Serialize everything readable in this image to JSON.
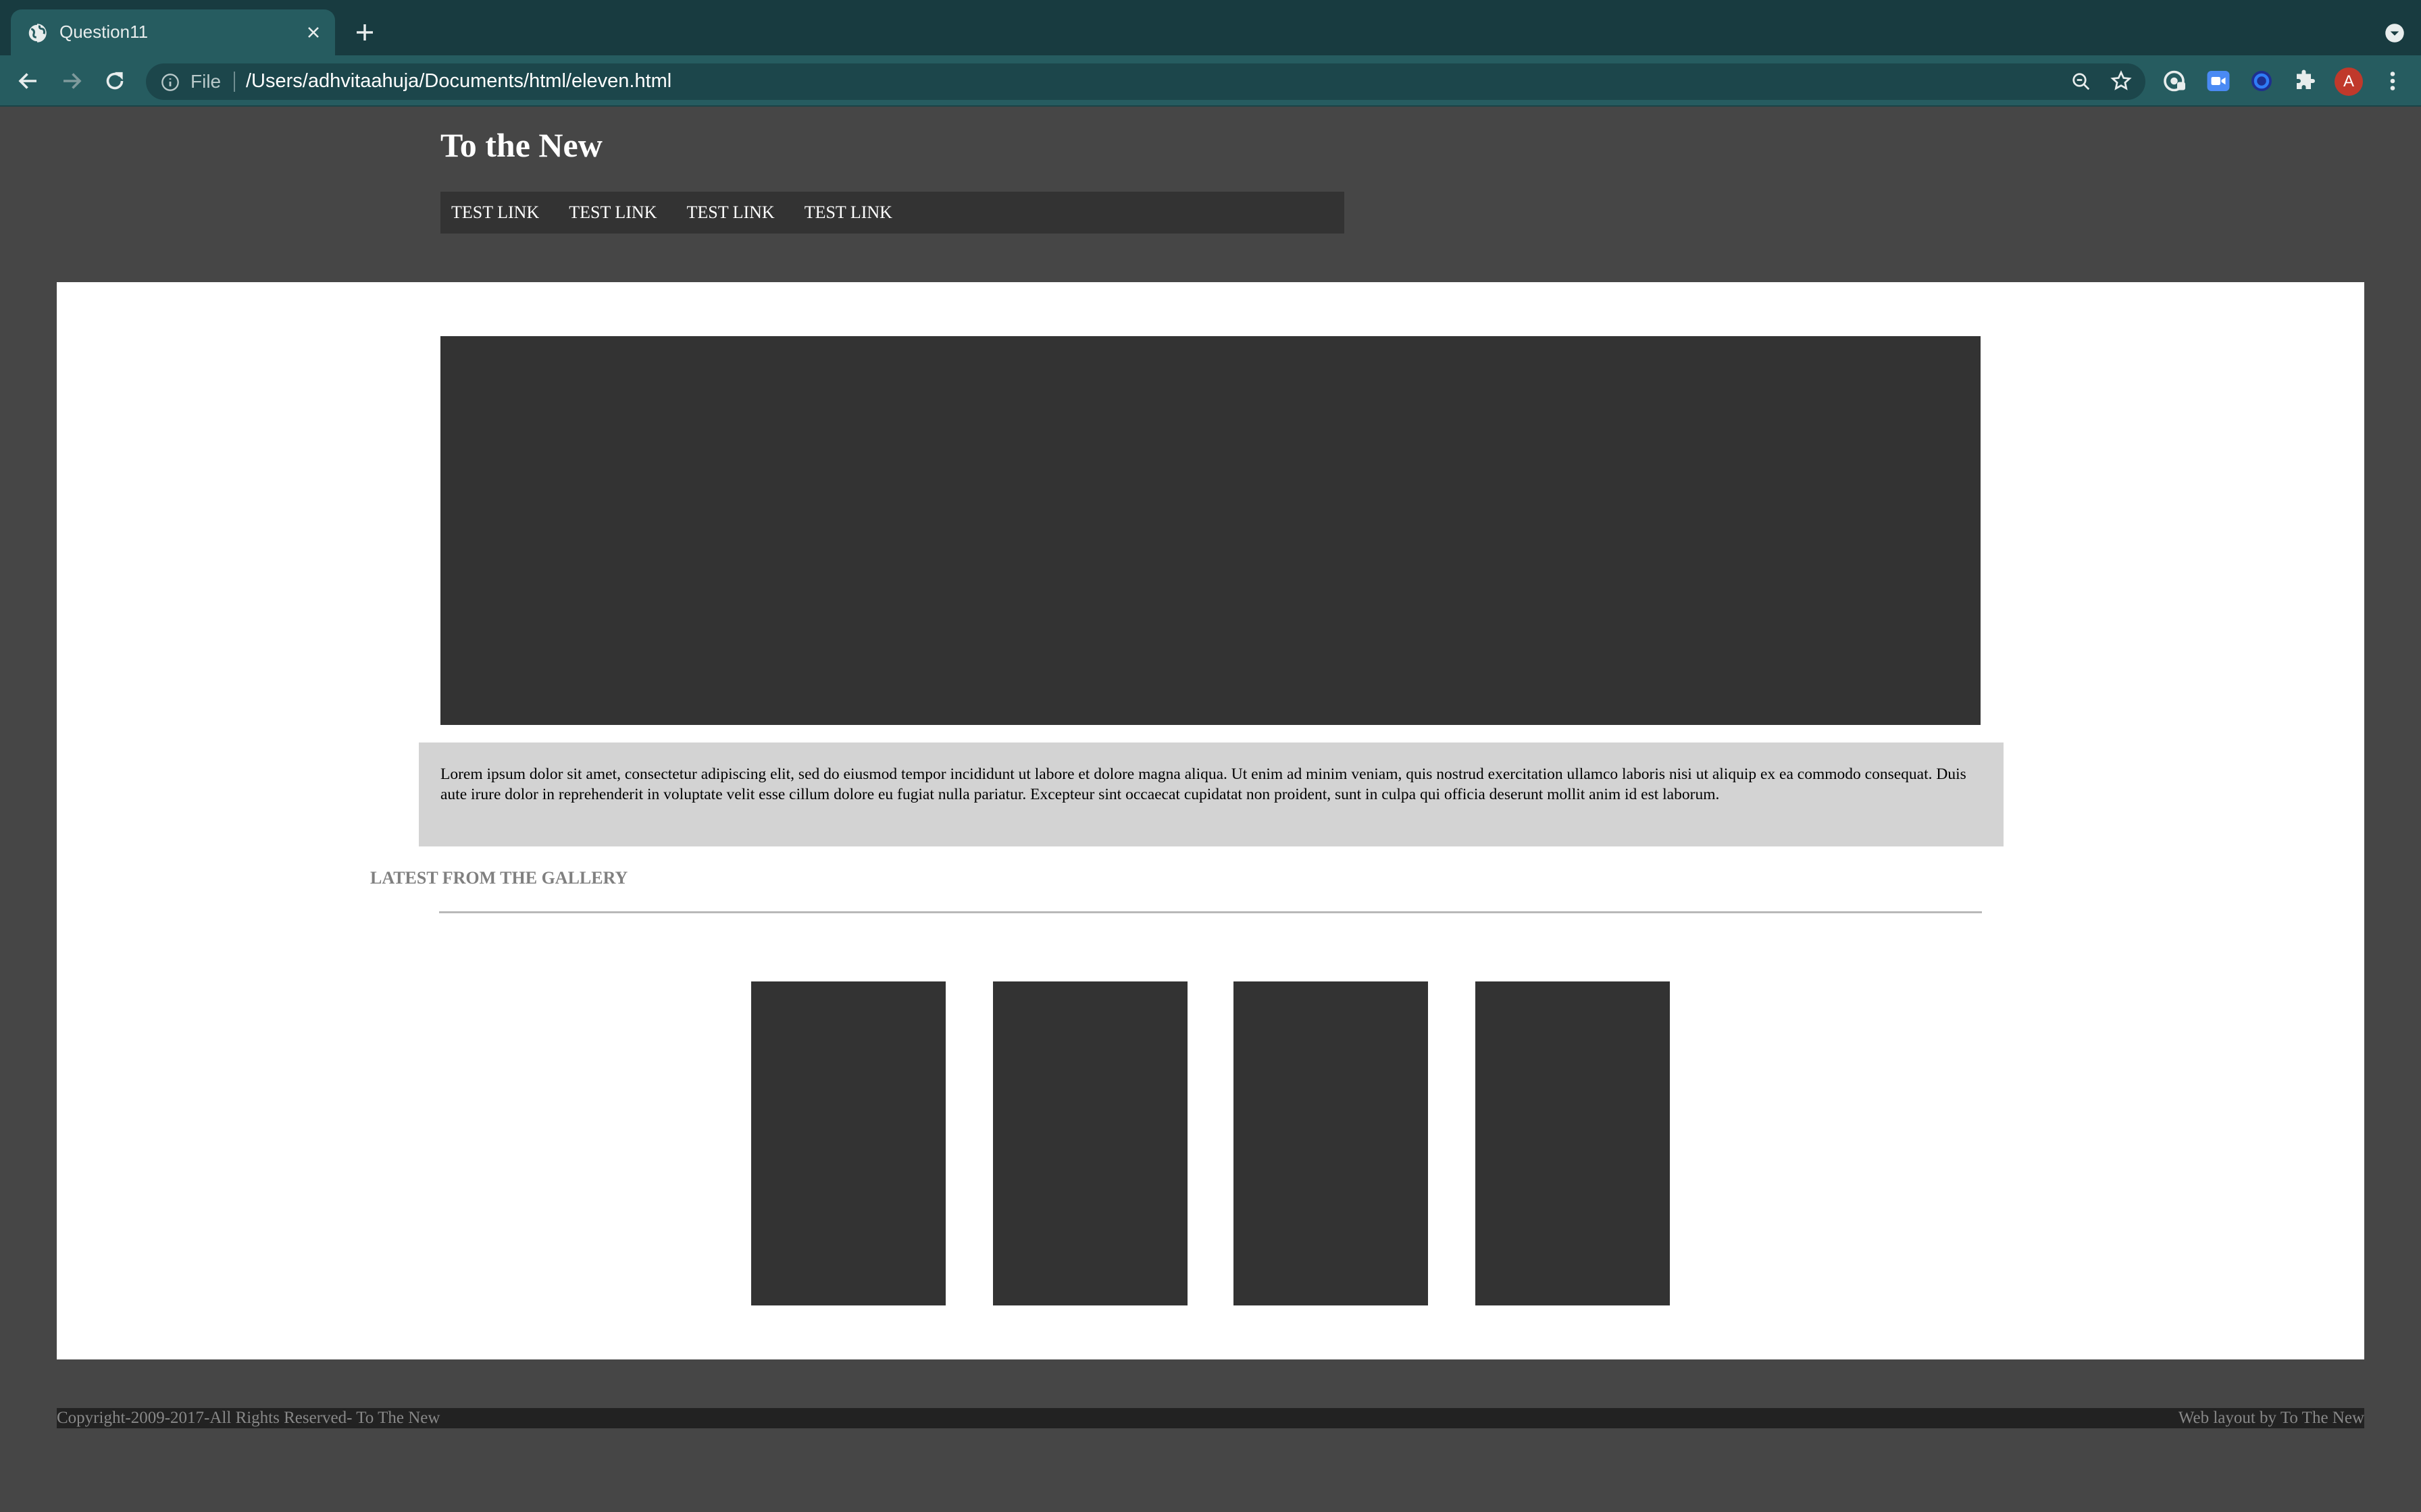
{
  "browser": {
    "tab_title": "Question11",
    "address_scheme": "File",
    "address_url": "/Users/adhvitaahuja/Documents/html/eleven.html",
    "profile_initial": "A",
    "colors": {
      "tabstrip": "#183b40",
      "toolbar": "#265c60",
      "omnibox": "#1c464b"
    }
  },
  "site": {
    "title": "To the New",
    "nav": [
      "TEST LINK",
      "TEST LINK",
      "TEST LINK",
      "TEST LINK"
    ],
    "intro_text": "Lorem ipsum dolor sit amet, consectetur adipiscing elit, sed do eiusmod tempor incididunt ut labore et dolore magna aliqua. Ut enim ad minim veniam, quis nostrud exercitation ullamco laboris nisi ut aliquip ex ea commodo consequat. Duis aute irure dolor in reprehenderit in voluptate velit esse cillum dolore eu fugiat nulla pariatur. Excepteur sint occaecat cupidatat non proident, sunt in culpa qui officia deserunt mollit anim id est laborum.",
    "gallery_heading": "LATEST FROM THE GALLERY",
    "footer_left": "Copyright-2009-2017-All Rights Reserved- To The New",
    "footer_right": "Web layout by To The New",
    "colors": {
      "page_bg": "#464646",
      "placeholder": "#333333",
      "intro_bg": "#d3d3d3"
    }
  }
}
